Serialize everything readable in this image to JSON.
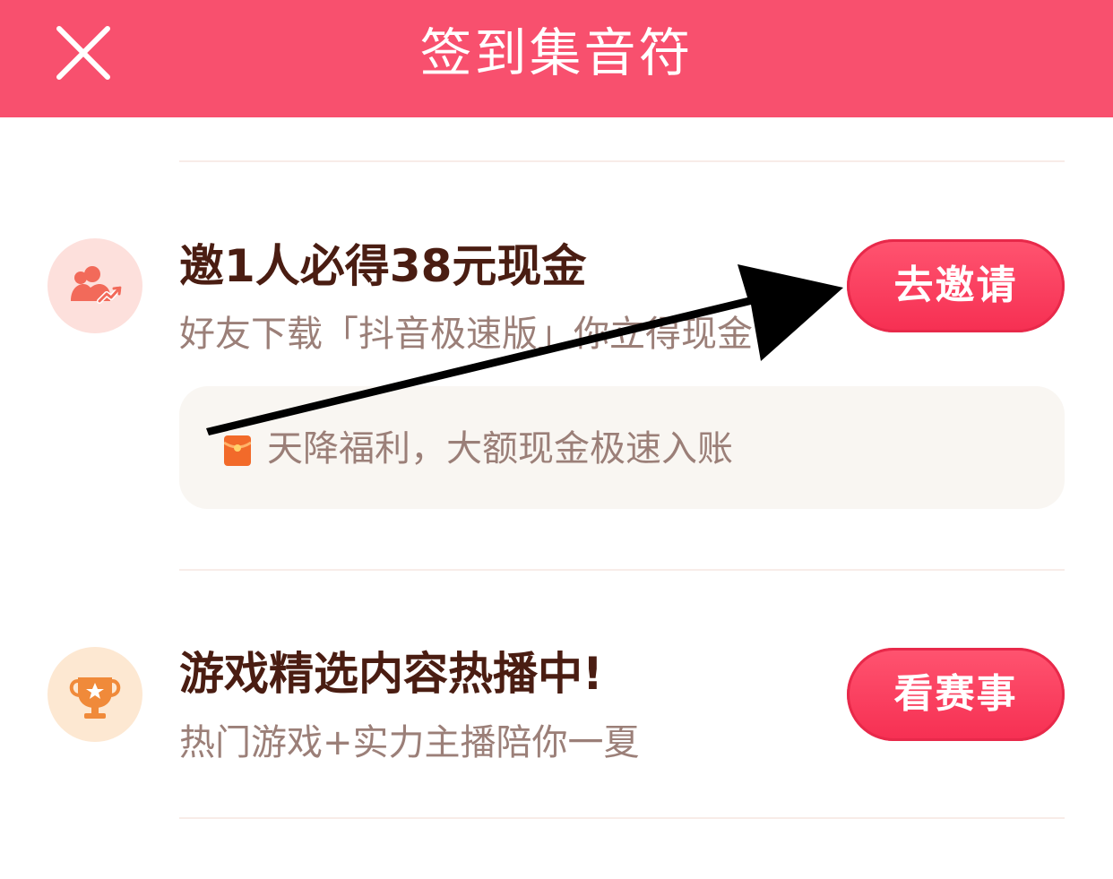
{
  "header": {
    "title": "签到集音符",
    "close_icon": "close-icon",
    "background": "#f8506e"
  },
  "tasks": [
    {
      "icon": "users-growth-icon",
      "icon_bg": "#fde0dc",
      "title": "邀1人必得38元现金",
      "desc": "好友下载「抖音极速版」你立得现金",
      "button": "去邀请",
      "promo": {
        "icon": "red-envelope-icon",
        "text": "天降福利，大额现金极速入账"
      }
    },
    {
      "icon": "trophy-icon",
      "icon_bg": "#fde8d2",
      "title": "游戏精选内容热播中!",
      "desc": "热门游戏+实力主播陪你一夏",
      "button": "看赛事"
    }
  ],
  "annotation": {
    "type": "arrow-pointer",
    "color": "#000000",
    "target": "去邀请"
  },
  "colors": {
    "accent": "#f8506e",
    "button": "#f62f52",
    "title_text": "#4a1d12",
    "desc_text": "#9b7f78"
  }
}
